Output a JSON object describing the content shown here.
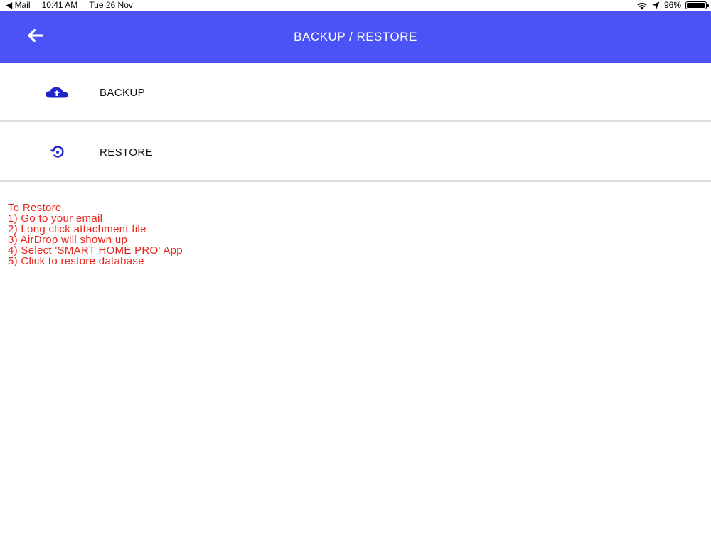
{
  "status_bar": {
    "back_app": "◀ Mail",
    "time": "10:41 AM",
    "date": "Tue 26 Nov",
    "battery_text": "96%",
    "battery_level": 0.96,
    "icons": [
      "wifi-icon",
      "location-arrow-icon",
      "battery-icon"
    ]
  },
  "header": {
    "title": "BACKUP / RESTORE",
    "background_color": "#4b53f7",
    "back_icon": "arrow-left-icon"
  },
  "menu": {
    "backup": {
      "label": "BACKUP",
      "icon": "cloud-upload-icon",
      "icon_color": "#1f24c8"
    },
    "restore": {
      "label": "RESTORE",
      "icon": "restore-icon",
      "icon_color": "#1f24c8"
    }
  },
  "instructions": {
    "color": "#e8241a",
    "lines": [
      "To Restore",
      "1) Go to your email",
      "2) Long click attachment file",
      "3) AirDrop will shown up",
      "4) Select 'SMART HOME PRO' App",
      "5) Click to restore database"
    ]
  }
}
